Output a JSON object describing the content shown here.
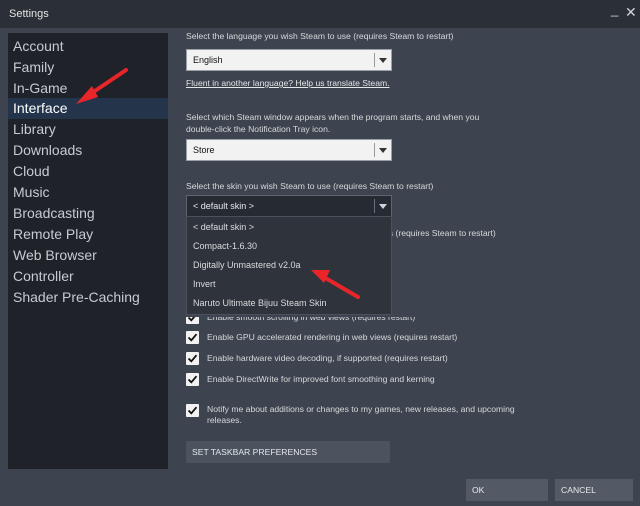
{
  "window": {
    "title": "Settings",
    "minimize_glyph": "_",
    "close_glyph": "✕"
  },
  "sidebar": {
    "items": [
      {
        "label": "Account"
      },
      {
        "label": "Family"
      },
      {
        "label": "In-Game"
      },
      {
        "label": "Interface",
        "active": true
      },
      {
        "label": "Library"
      },
      {
        "label": "Downloads"
      },
      {
        "label": "Cloud"
      },
      {
        "label": "Music"
      },
      {
        "label": "Broadcasting"
      },
      {
        "label": "Remote Play"
      },
      {
        "label": "Web Browser"
      },
      {
        "label": "Controller"
      },
      {
        "label": "Shader Pre-Caching"
      }
    ]
  },
  "language": {
    "prompt": "Select the language you wish Steam to use (requires Steam to restart)",
    "selected": "English",
    "translate_link": "Fluent in another language? Help us translate Steam."
  },
  "window_select": {
    "prompt_line1": "Select which Steam window appears when the program starts, and when you",
    "prompt_line2": "double-click the Notification Tray icon.",
    "selected": "Store"
  },
  "skin": {
    "prompt": "Select the skin you wish Steam to use (requires Steam to restart)",
    "selected": "< default skin >",
    "options": [
      "< default skin >",
      "Compact-1.6.30",
      "Digitally Unmastered v2.0a",
      "Invert",
      "Naruto Ultimate Bijuu Steam Skin"
    ],
    "hidden_partial_text": "gs (requires Steam to restart)"
  },
  "checkboxes": [
    {
      "label": "Enable smooth scrolling in web views (requires restart)",
      "checked": true
    },
    {
      "label": "Enable GPU accelerated rendering in web views (requires restart)",
      "checked": true
    },
    {
      "label": "Enable hardware video decoding, if supported (requires restart)",
      "checked": true
    },
    {
      "label": "Enable DirectWrite for improved font smoothing and kerning",
      "checked": true
    },
    {
      "label_line1": "Notify me about additions or changes to my games, new releases, and upcoming",
      "label_line2": "releases.",
      "checked": true
    }
  ],
  "taskbar_button": "SET TASKBAR PREFERENCES",
  "footer": {
    "ok": "OK",
    "cancel": "CANCEL"
  },
  "colors": {
    "accent_arrow": "#e8262a",
    "active_nav_bg": "#23344b"
  }
}
